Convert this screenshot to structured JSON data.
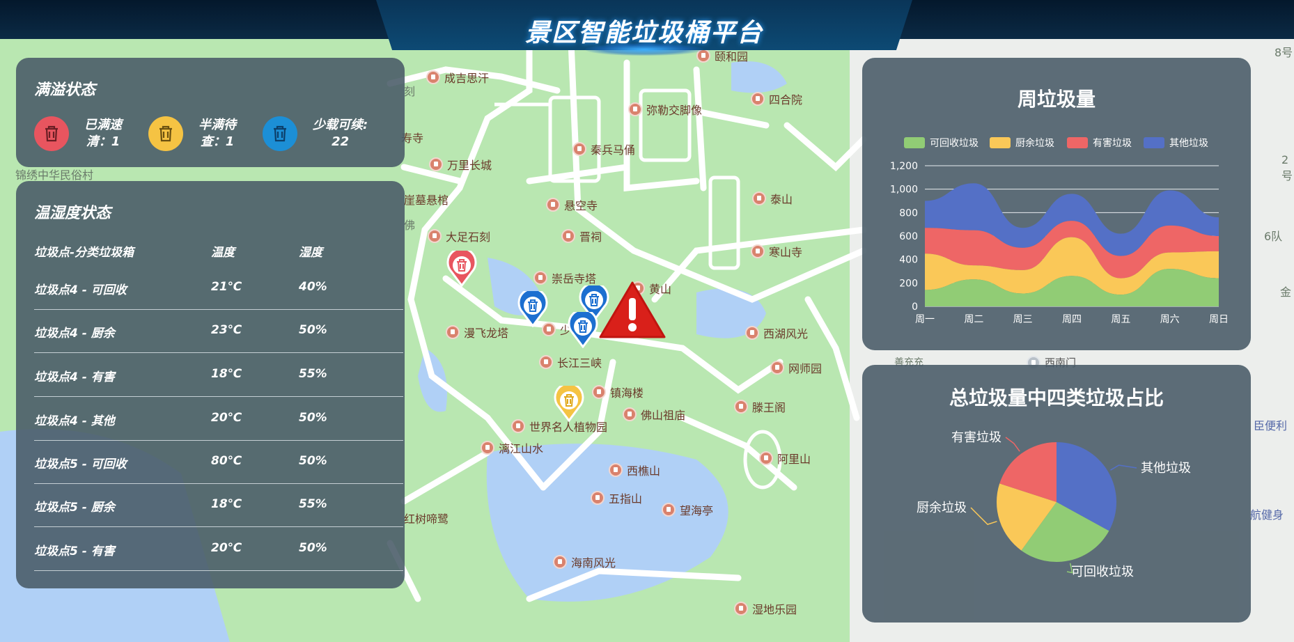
{
  "header": {
    "title": "景区智能垃圾桶平台"
  },
  "map": {
    "pois": [
      {
        "name": "成吉思汗"
      },
      {
        "name": "颐和园"
      },
      {
        "name": "四合院"
      },
      {
        "name": "弥勒交脚像"
      },
      {
        "name": "秦兵马俑"
      },
      {
        "name": "万里长城"
      },
      {
        "name": "寿寺"
      },
      {
        "name": "崖墓悬棺"
      },
      {
        "name": "悬空寺"
      },
      {
        "name": "泰山"
      },
      {
        "name": "晋祠"
      },
      {
        "name": "大足石刻"
      },
      {
        "name": "寒山寺"
      },
      {
        "name": "崇岳寺塔"
      },
      {
        "name": "黄山"
      },
      {
        "name": "漫飞龙塔"
      },
      {
        "name": "少"
      },
      {
        "name": "西湖风光"
      },
      {
        "name": "长江三峡"
      },
      {
        "name": "网师园"
      },
      {
        "name": "镇海楼"
      },
      {
        "name": "佛山祖庙"
      },
      {
        "name": "滕王阁"
      },
      {
        "name": "世界名人植物园"
      },
      {
        "name": "漓江山水"
      },
      {
        "name": "阿里山"
      },
      {
        "name": "西樵山"
      },
      {
        "name": "五指山"
      },
      {
        "name": "望海亭"
      },
      {
        "name": "红树啼鹭"
      },
      {
        "name": "海南风光"
      },
      {
        "name": "湿地乐园"
      },
      {
        "name": "西南门"
      }
    ],
    "labels": [
      "锦绣中华民俗村",
      "佛",
      "刻",
      "善充充",
      "8号",
      "2号",
      "6队",
      "臣便利",
      "航健身",
      "金"
    ]
  },
  "overflow": {
    "title": "满溢状态",
    "stats": [
      {
        "label_1": "已满速",
        "label_2": "清：1",
        "color": "#e8555f",
        "icon": "trash-icon"
      },
      {
        "label_1": "半满待",
        "label_2": "查：1",
        "color": "#f5c343",
        "icon": "trash-icon"
      },
      {
        "label_1": "少载可续:",
        "label_2": "22",
        "color": "#1c8fd6",
        "icon": "trash-icon"
      }
    ]
  },
  "temp": {
    "title": "温湿度状态",
    "headers": [
      "垃圾点-分类垃圾箱",
      "温度",
      "湿度"
    ],
    "rows": [
      {
        "point": "垃圾点4 - 可回收",
        "temp": "21℃",
        "hum": "40%"
      },
      {
        "point": "垃圾点4 - 厨余",
        "temp": "23℃",
        "hum": "50%"
      },
      {
        "point": "垃圾点4 - 有害",
        "temp": "18℃",
        "hum": "55%"
      },
      {
        "point": "垃圾点4 - 其他",
        "temp": "20℃",
        "hum": "50%"
      },
      {
        "point": "垃圾点5 - 可回收",
        "temp": "80℃",
        "hum": "50%"
      },
      {
        "point": "垃圾点5 - 厨余",
        "temp": "18℃",
        "hum": "55%"
      },
      {
        "point": "垃圾点5 - 有害",
        "temp": "20℃",
        "hum": "50%"
      }
    ]
  },
  "chart_data": [
    {
      "type": "area",
      "title": "周垃圾量",
      "categories": [
        "周一",
        "周二",
        "周三",
        "周四",
        "周五",
        "周六",
        "周日"
      ],
      "yticks": [
        "0",
        "200",
        "400",
        "600",
        "800",
        "1,000",
        "1,200"
      ],
      "ylim": [
        0,
        1200
      ],
      "stacked": true,
      "legend": "top",
      "grid": true,
      "series": [
        {
          "name": "可回收垃圾",
          "color": "#91cc75",
          "values": [
            140,
            230,
            110,
            260,
            100,
            320,
            240
          ]
        },
        {
          "name": "厨余垃圾",
          "color": "#fac858",
          "values": [
            310,
            120,
            200,
            330,
            140,
            140,
            230
          ]
        },
        {
          "name": "有害垃圾",
          "color": "#ee6666",
          "values": [
            220,
            300,
            190,
            140,
            190,
            230,
            130
          ]
        },
        {
          "name": "其他垃圾",
          "color": "#5470c6",
          "values": [
            230,
            400,
            170,
            230,
            190,
            300,
            160
          ]
        }
      ]
    },
    {
      "type": "pie",
      "title": "总垃圾量中四类垃圾占比",
      "slices": [
        {
          "name": "其他垃圾",
          "value": 33,
          "color": "#5470c6"
        },
        {
          "name": "可回收垃圾",
          "value": 27,
          "color": "#91cc75"
        },
        {
          "name": "厨余垃圾",
          "value": 20,
          "color": "#fac858"
        },
        {
          "name": "有害垃圾",
          "value": 20,
          "color": "#ee6666"
        }
      ]
    }
  ]
}
